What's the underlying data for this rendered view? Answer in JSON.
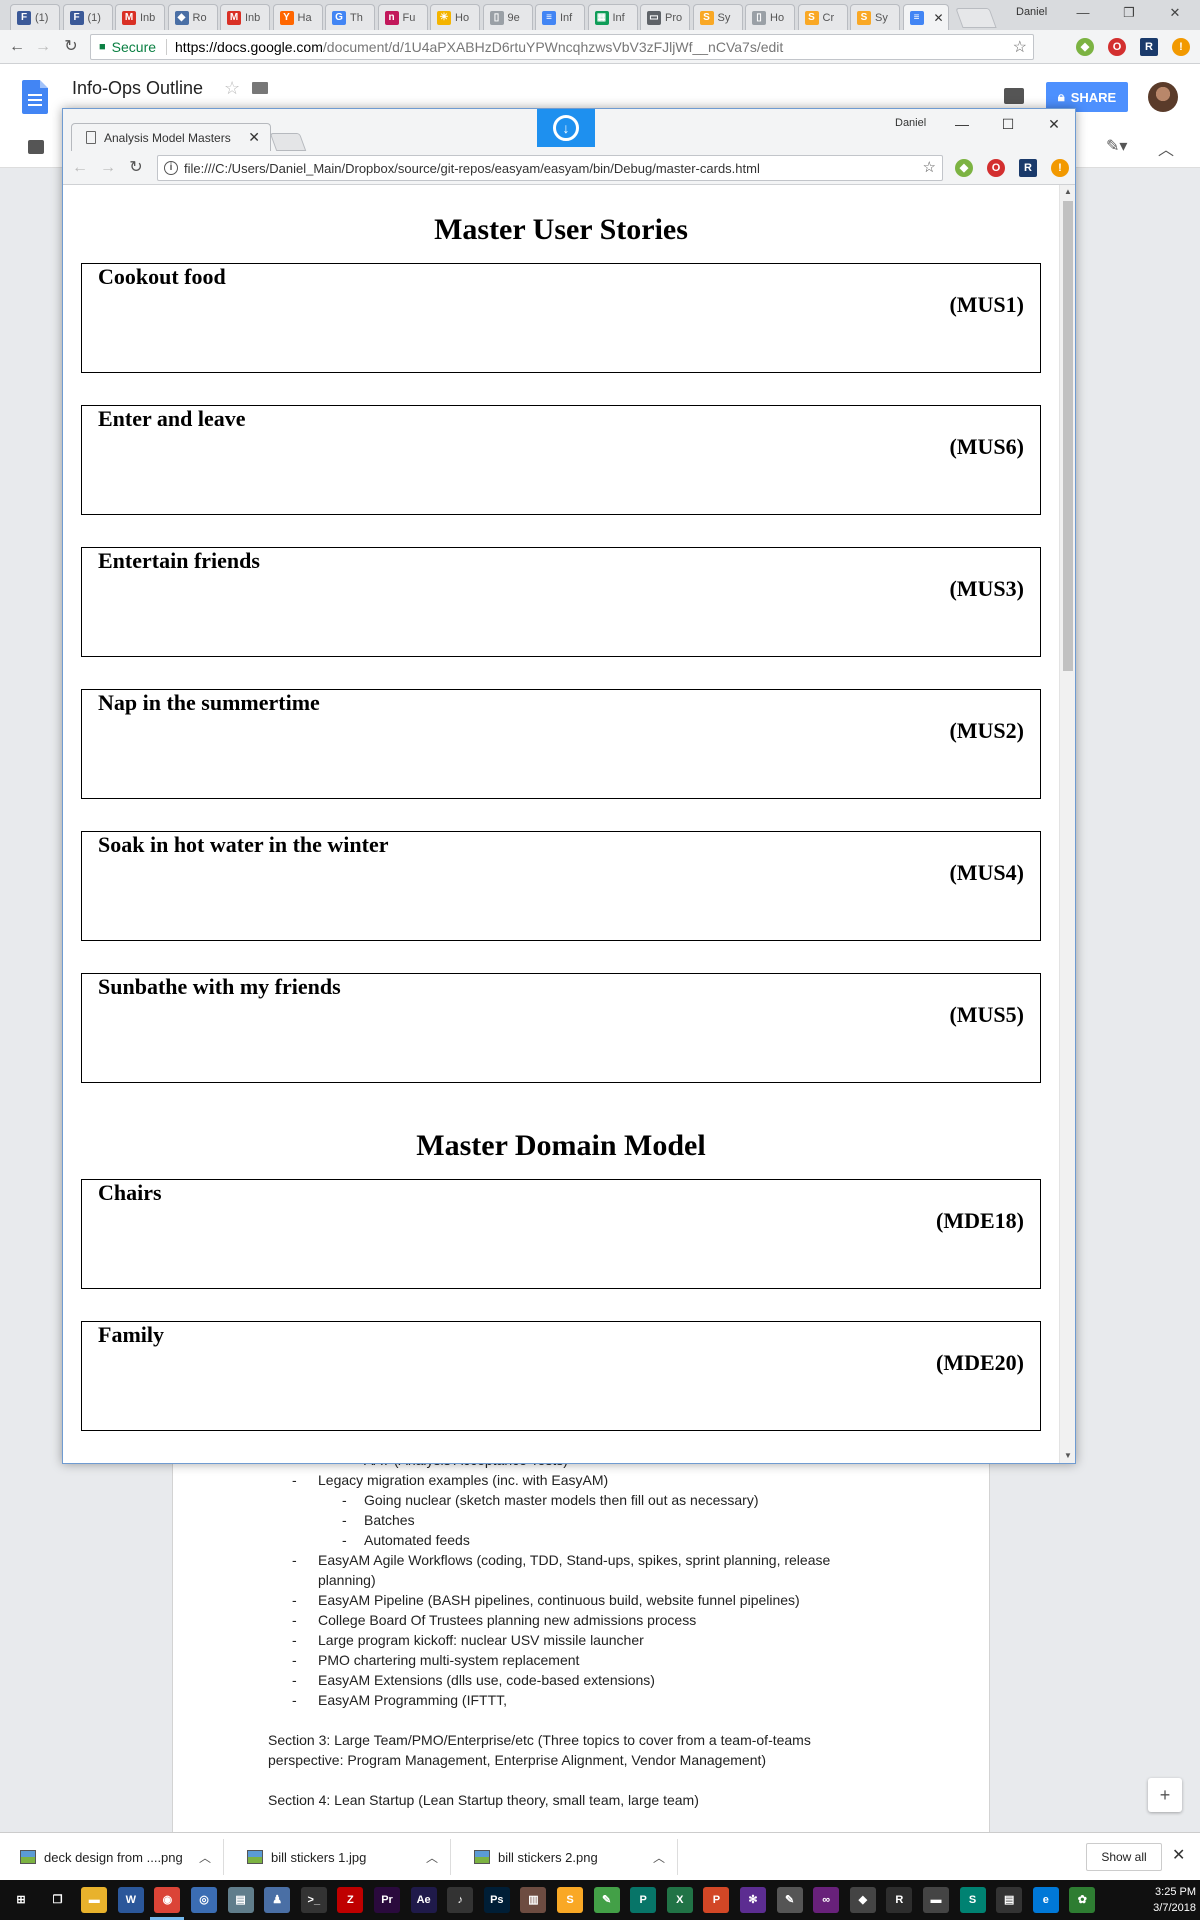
{
  "outer_browser": {
    "tabs": [
      {
        "label": "(1)",
        "fav": "F",
        "color": "#3b5998"
      },
      {
        "label": "(1)",
        "fav": "F",
        "color": "#3b5998"
      },
      {
        "label": "Inb",
        "fav": "M",
        "color": "#d93025"
      },
      {
        "label": "Ro",
        "fav": "◆",
        "color": "#4a6fa5"
      },
      {
        "label": "Inb",
        "fav": "M",
        "color": "#d93025"
      },
      {
        "label": "Ha",
        "fav": "Y",
        "color": "#ff6600"
      },
      {
        "label": "Th",
        "fav": "G",
        "color": "#4285f4"
      },
      {
        "label": "Fu",
        "fav": "n",
        "color": "#c2185b"
      },
      {
        "label": "Ho",
        "fav": "☀",
        "color": "#f4b400"
      },
      {
        "label": "9e",
        "fav": "▯",
        "color": "#9aa0a6"
      },
      {
        "label": "Inf",
        "fav": "≡",
        "color": "#4285f4"
      },
      {
        "label": "Inf",
        "fav": "▦",
        "color": "#0f9d58"
      },
      {
        "label": "Pro",
        "fav": "▭",
        "color": "#5f6368"
      },
      {
        "label": "Sy",
        "fav": "S",
        "color": "#f9a825"
      },
      {
        "label": "Ho",
        "fav": "▯",
        "color": "#9aa0a6"
      },
      {
        "label": "Cr",
        "fav": "S",
        "color": "#f9a825"
      },
      {
        "label": "Sy",
        "fav": "S",
        "color": "#f9a825"
      },
      {
        "label": "",
        "fav": "≡",
        "color": "#4285f4",
        "active": true
      }
    ],
    "active_tab_close": "✕",
    "user_name": "Daniel",
    "url_secure_label": "Secure",
    "url_host": "https://docs.google.com",
    "url_path": "/document/d/1U4aPXABHzD6rtuYPWncqhzwsVbV3zFJljWf__nCVa7s/edit",
    "nav_back": "←",
    "nav_forward": "→",
    "nav_reload": "↻",
    "star": "☆",
    "ext_r": "R",
    "ext_o": "O",
    "ext_warn": "!",
    "menu": "⋮"
  },
  "docs": {
    "title": "Info-Ops Outline",
    "share_label": "SHARE",
    "star": "☆",
    "body_lines": [
      {
        "level": 2,
        "text": "AAT (Analysis Acceptance Tests)"
      },
      {
        "level": 1,
        "text": "Legacy migration examples  (inc. with EasyAM)"
      },
      {
        "level": 2,
        "text": "Going nuclear (sketch master models then fill out as necessary)"
      },
      {
        "level": 2,
        "text": "Batches"
      },
      {
        "level": 2,
        "text": "Automated feeds"
      },
      {
        "level": 1,
        "text": "EasyAM Agile Workflows (coding, TDD, Stand-ups, spikes, sprint planning, release planning)"
      },
      {
        "level": 1,
        "text": "EasyAM Pipeline (BASH pipelines, continuous build, website funnel pipelines)"
      },
      {
        "level": 1,
        "text": "College Board Of Trustees planning new admissions process"
      },
      {
        "level": 1,
        "text": "Large program kickoff: nuclear USV missile launcher"
      },
      {
        "level": 1,
        "text": "PMO chartering multi-system replacement"
      },
      {
        "level": 1,
        "text": "EasyAM Extensions (dlls use, code-based extensions)"
      },
      {
        "level": 1,
        "text": "EasyAM Programming (IFTTT,"
      },
      {
        "level": 0,
        "text": ""
      },
      {
        "level": 0,
        "text": "Section 3: Large Team/PMO/Enterprise/etc (Three topics to cover from a team-of-teams perspective: Program Management, Enterprise Alignment, Vendor Management)"
      },
      {
        "level": 0,
        "text": ""
      },
      {
        "level": 0,
        "text": "Section 4: Lean Startup (Lean Startup theory, small team, large team)"
      }
    ]
  },
  "popup": {
    "tab_title": "Analysis Model Masters",
    "tab_close": "✕",
    "user_name": "Daniel",
    "minimize": "—",
    "maximize": "☐",
    "close": "✕",
    "url": "file:///C:/Users/Daniel_Main/Dropbox/source/git-repos/easyam/easyam/bin/Debug/master-cards.html",
    "info": "i",
    "star": "☆",
    "nav_back": "←",
    "nav_forward": "→",
    "nav_reload": "↻"
  },
  "page": {
    "sections": [
      {
        "title": "Master User Stories",
        "cards": [
          {
            "title": "Cookout food",
            "id": "(MUS1)"
          },
          {
            "title": "Enter and leave",
            "id": "(MUS6)"
          },
          {
            "title": "Entertain friends",
            "id": "(MUS3)"
          },
          {
            "title": "Nap in the summertime",
            "id": "(MUS2)"
          },
          {
            "title": "Soak in hot water in the winter",
            "id": "(MUS4)"
          },
          {
            "title": "Sunbathe with my friends",
            "id": "(MUS5)"
          }
        ]
      },
      {
        "title": "Master Domain Model",
        "cards": [
          {
            "title": "Chairs",
            "id": "(MDE18)"
          },
          {
            "title": "Family",
            "id": "(MDE20)"
          }
        ]
      }
    ]
  },
  "downloads": {
    "items": [
      {
        "name": "deck design from ....png"
      },
      {
        "name": "bill stickers 1.jpg"
      },
      {
        "name": "bill stickers 2.png"
      }
    ],
    "show_all": "Show all",
    "close": "✕"
  },
  "taskbar": {
    "time": "3:25 PM",
    "date": "3/7/2018",
    "icons": [
      {
        "name": "windows-start-icon",
        "glyph": "⊞",
        "color": "#101010"
      },
      {
        "name": "task-view-icon",
        "glyph": "❐",
        "color": "#101010"
      },
      {
        "name": "file-explorer-icon",
        "glyph": "▬",
        "color": "#e8b22c"
      },
      {
        "name": "word-icon",
        "glyph": "W",
        "color": "#2b579a"
      },
      {
        "name": "chrome-icon",
        "glyph": "◉",
        "color": "#db4437"
      },
      {
        "name": "app-icon-1",
        "glyph": "◎",
        "color": "#3b6db3"
      },
      {
        "name": "app-icon-2",
        "glyph": "▤",
        "color": "#607d8b"
      },
      {
        "name": "app-icon-3",
        "glyph": "♟",
        "color": "#4a6fa5"
      },
      {
        "name": "terminal-icon",
        "glyph": ">_",
        "color": "#333"
      },
      {
        "name": "filezilla-icon",
        "glyph": "Z",
        "color": "#bf0000"
      },
      {
        "name": "premiere-icon",
        "glyph": "Pr",
        "color": "#2a0a3d"
      },
      {
        "name": "after-effects-icon",
        "glyph": "Ae",
        "color": "#1f1a4a"
      },
      {
        "name": "audacity-icon",
        "glyph": "♪",
        "color": "#333"
      },
      {
        "name": "photoshop-icon",
        "glyph": "Ps",
        "color": "#001e36"
      },
      {
        "name": "library-icon",
        "glyph": "▥",
        "color": "#6d4c41"
      },
      {
        "name": "sublime-icon",
        "glyph": "S",
        "color": "#f9a825"
      },
      {
        "name": "notepad-icon",
        "glyph": "✎",
        "color": "#43a047"
      },
      {
        "name": "publisher-icon",
        "glyph": "P",
        "color": "#077568"
      },
      {
        "name": "excel-icon",
        "glyph": "X",
        "color": "#217346"
      },
      {
        "name": "powerpoint-icon",
        "glyph": "P",
        "color": "#d24726"
      },
      {
        "name": "app-icon-4",
        "glyph": "✻",
        "color": "#5c2d91"
      },
      {
        "name": "app-icon-5",
        "glyph": "✎",
        "color": "#555"
      },
      {
        "name": "visual-studio-icon",
        "glyph": "∞",
        "color": "#68217a"
      },
      {
        "name": "git-icon",
        "glyph": "◆",
        "color": "#444"
      },
      {
        "name": "app-icon-6",
        "glyph": "R",
        "color": "#2d2d2d"
      },
      {
        "name": "app-icon-7",
        "glyph": "▬",
        "color": "#444"
      },
      {
        "name": "sway-icon",
        "glyph": "S",
        "color": "#008272"
      },
      {
        "name": "notes-icon",
        "glyph": "▤",
        "color": "#333"
      },
      {
        "name": "edge-icon",
        "glyph": "e",
        "color": "#0078d7"
      },
      {
        "name": "app-icon-8",
        "glyph": "✿",
        "color": "#2e7d32"
      }
    ]
  }
}
